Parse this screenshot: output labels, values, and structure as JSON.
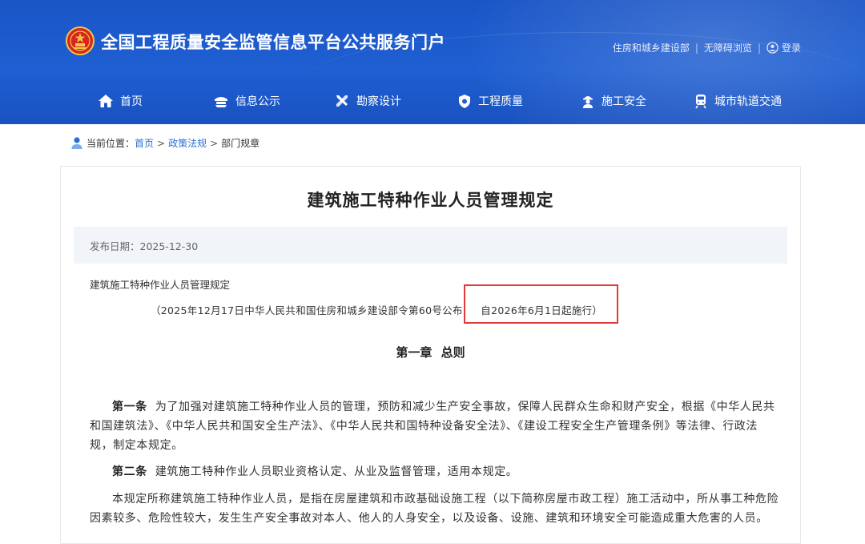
{
  "header": {
    "site_title": "全国工程质量安全监管信息平台公共服务门户",
    "links": {
      "ministry": "住房和城乡建设部",
      "accessibility": "无障碍浏览",
      "login": "登录"
    },
    "nav": [
      {
        "label": "首页",
        "icon": "home-icon"
      },
      {
        "label": "信息公示",
        "icon": "info-icon"
      },
      {
        "label": "勘察设计",
        "icon": "tools-icon"
      },
      {
        "label": "工程质量",
        "icon": "shield-icon"
      },
      {
        "label": "施工安全",
        "icon": "worker-icon"
      },
      {
        "label": "城市轨道交通",
        "icon": "train-icon"
      }
    ],
    "colors": {
      "header_bg": "#1f5fd2",
      "link_blue": "#2b6fd1",
      "highlight_red": "#e23a3a"
    }
  },
  "breadcrumb": {
    "prefix": "当前位置：",
    "items": [
      "首页",
      "政策法规",
      "部门规章"
    ]
  },
  "article": {
    "title": "建筑施工特种作业人员管理规定",
    "publish_date": "发布日期：2025-12-30",
    "doc_name": "建筑施工特种作业人员管理规定",
    "issuance_part1": "（2025年12月17日中华人民共和国住房和城乡建设部令第60号公布",
    "issuance_part2": "自2026年6月1日起施行）",
    "chapter": "第一章 总则",
    "articles": [
      {
        "label": "第一条",
        "text": "为了加强对建筑施工特种作业人员的管理，预防和减少生产安全事故，保障人民群众生命和财产安全，根据《中华人民共和国建筑法》、《中华人民共和国安全生产法》、《中华人民共和国特种设备安全法》、《建设工程安全生产管理条例》等法律、行政法规，制定本规定。"
      },
      {
        "label": "第二条",
        "text": "建筑施工特种作业人员职业资格认定、从业及监督管理，适用本规定。"
      },
      {
        "label": "",
        "text": "本规定所称建筑施工特种作业人员，是指在房屋建筑和市政基础设施工程（以下简称房屋市政工程）施工活动中，所从事工种危险因素较多、危险性较大，发生生产安全事故对本人、他人的人身安全，以及设备、设施、建筑和环境安全可能造成重大危害的人员。"
      }
    ]
  }
}
